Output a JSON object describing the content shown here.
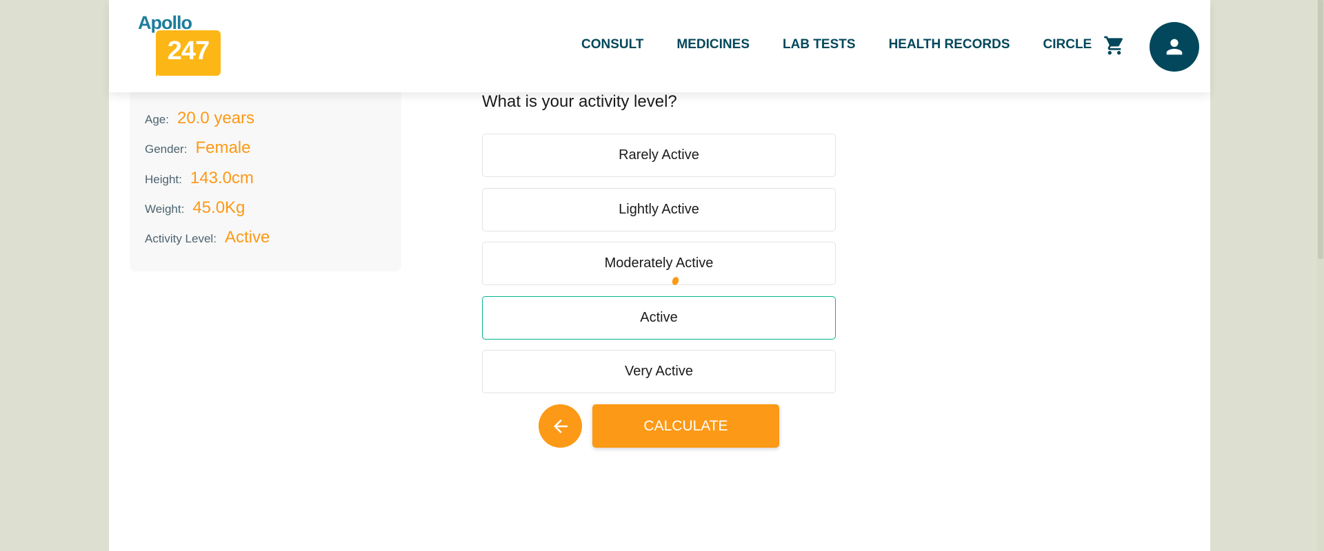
{
  "brand": {
    "logo_word": "Apollo",
    "logo_number": "247",
    "colors": {
      "primary": "#02475b",
      "accent": "#fc9916",
      "logo_yellow": "#fcb716",
      "logo_blue": "#1d7d9a",
      "selected_border": "#00b38e"
    }
  },
  "nav": {
    "items": [
      {
        "label": "CONSULT"
      },
      {
        "label": "MEDICINES"
      },
      {
        "label": "LAB TESTS"
      },
      {
        "label": "HEALTH RECORDS"
      },
      {
        "label": "CIRCLE"
      }
    ],
    "cart_icon": "cart-icon",
    "profile_icon": "user-icon"
  },
  "profile": {
    "fields": [
      {
        "label": "Age:",
        "value": "20.0 years"
      },
      {
        "label": "Gender:",
        "value": "Female"
      },
      {
        "label": "Height:",
        "value": "143.0cm"
      },
      {
        "label": "Weight:",
        "value": "45.0Kg"
      },
      {
        "label": "Activity Level:",
        "value": "Active"
      }
    ]
  },
  "question": {
    "text": "What is your activity level?",
    "options": [
      {
        "label": "Rarely Active"
      },
      {
        "label": "Lightly Active"
      },
      {
        "label": "Moderately Active"
      },
      {
        "label": "Active"
      },
      {
        "label": "Very Active"
      }
    ],
    "selected": "Active"
  },
  "actions": {
    "back_icon": "arrow-left-icon",
    "calculate_label": "CALCULATE"
  }
}
